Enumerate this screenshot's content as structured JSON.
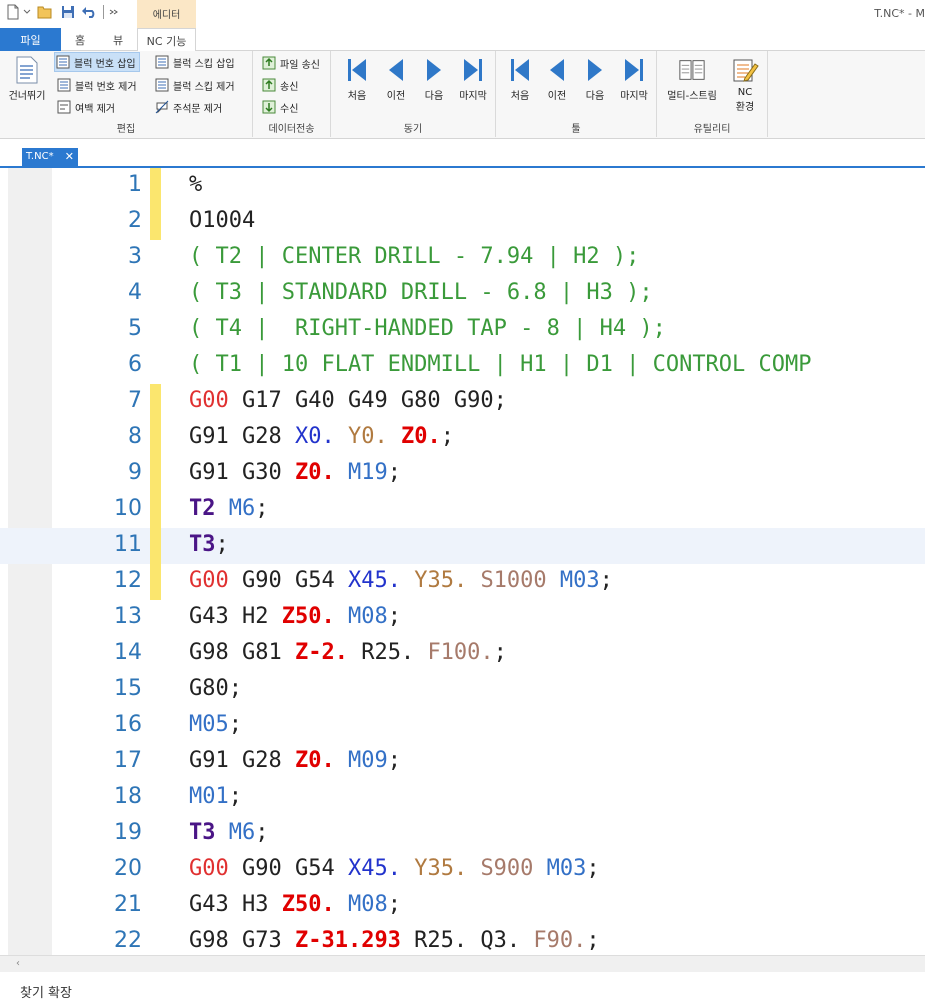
{
  "window": {
    "title": "T.NC* - M"
  },
  "context_tab": {
    "label": "에디터"
  },
  "ribbon_tabs": [
    {
      "label": "파일"
    },
    {
      "label": "홈"
    },
    {
      "label": "뷰"
    },
    {
      "label": "NC 기능"
    }
  ],
  "ribbon": {
    "edit_group": {
      "label": "편집",
      "skip_button": "건너뛰기",
      "items": [
        {
          "label": "블럭 번호 삽입",
          "icon": "block-number-insert-icon"
        },
        {
          "label": "블럭 번호 제거",
          "icon": "block-number-remove-icon"
        },
        {
          "label": "여백 제거",
          "icon": "remove-whitespace-icon"
        },
        {
          "label": "블럭 스킵 삽입",
          "icon": "block-skip-insert-icon"
        },
        {
          "label": "블럭 스킵 제거",
          "icon": "block-skip-remove-icon"
        },
        {
          "label": "주석문 제거",
          "icon": "remove-comment-icon"
        }
      ]
    },
    "transfer_group": {
      "label": "데이터전송",
      "items": [
        {
          "label": "파일 송신",
          "icon": "file-send-icon"
        },
        {
          "label": "송신",
          "icon": "send-icon"
        },
        {
          "label": "수신",
          "icon": "receive-icon"
        }
      ]
    },
    "sync_group": {
      "label": "동기",
      "items": [
        {
          "label": "처음",
          "icon": "first-icon"
        },
        {
          "label": "이전",
          "icon": "previous-icon"
        },
        {
          "label": "다음",
          "icon": "next-icon"
        },
        {
          "label": "마지막",
          "icon": "last-icon"
        }
      ]
    },
    "tool_group": {
      "label": "툴",
      "items": [
        {
          "label": "처음",
          "icon": "first-icon"
        },
        {
          "label": "이전",
          "icon": "previous-icon"
        },
        {
          "label": "다음",
          "icon": "next-icon"
        },
        {
          "label": "마지막",
          "icon": "last-icon"
        }
      ]
    },
    "utility_group": {
      "label": "유틸리티",
      "multi_stream": "멀티-스트림",
      "nc_env_line1": "NC",
      "nc_env_line2": "환경"
    }
  },
  "document_tab": {
    "label": "T.NC*"
  },
  "editor": {
    "lines": [
      {
        "n": "1",
        "mark": true,
        "cur": false,
        "tokens": [
          {
            "t": "%",
            "c": "def"
          }
        ]
      },
      {
        "n": "2",
        "mark": true,
        "cur": false,
        "tokens": [
          {
            "t": "O1004",
            "c": "def"
          }
        ]
      },
      {
        "n": "3",
        "mark": false,
        "cur": false,
        "tokens": [
          {
            "t": "( T2 | CENTER DRILL - 7.94 | H2 );",
            "c": "cmt"
          }
        ]
      },
      {
        "n": "4",
        "mark": false,
        "cur": false,
        "tokens": [
          {
            "t": "( T3 | STANDARD DRILL - 6.8 | H3 );",
            "c": "cmt"
          }
        ]
      },
      {
        "n": "5",
        "mark": false,
        "cur": false,
        "tokens": [
          {
            "t": "( T4 |  RIGHT-HANDED TAP - 8 | H4 );",
            "c": "cmt"
          }
        ]
      },
      {
        "n": "6",
        "mark": false,
        "cur": false,
        "tokens": [
          {
            "t": "( T1 | 10 FLAT ENDMILL | H1 | D1 | CONTROL COMP",
            "c": "cmt"
          }
        ]
      },
      {
        "n": "7",
        "mark": true,
        "cur": false,
        "tokens": [
          {
            "t": "G00",
            "c": "gr"
          },
          {
            "t": " G17 G40 G49 G80 G90;",
            "c": "def"
          }
        ]
      },
      {
        "n": "8",
        "mark": true,
        "cur": false,
        "tokens": [
          {
            "t": "G91 G28 ",
            "c": "def"
          },
          {
            "t": "X0.",
            "c": "x"
          },
          {
            "t": " ",
            "c": "def"
          },
          {
            "t": "Y0.",
            "c": "y"
          },
          {
            "t": " ",
            "c": "def"
          },
          {
            "t": "Z0.",
            "c": "z"
          },
          {
            "t": ";",
            "c": "def"
          }
        ]
      },
      {
        "n": "9",
        "mark": true,
        "cur": false,
        "tokens": [
          {
            "t": "G91 G30 ",
            "c": "def"
          },
          {
            "t": "Z0.",
            "c": "z"
          },
          {
            "t": " ",
            "c": "def"
          },
          {
            "t": "M19",
            "c": "m"
          },
          {
            "t": ";",
            "c": "def"
          }
        ]
      },
      {
        "n": "10",
        "mark": true,
        "cur": false,
        "tokens": [
          {
            "t": "T2",
            "c": "t"
          },
          {
            "t": " ",
            "c": "def"
          },
          {
            "t": "M6",
            "c": "m"
          },
          {
            "t": ";",
            "c": "def"
          }
        ]
      },
      {
        "n": "11",
        "mark": true,
        "cur": true,
        "tokens": [
          {
            "t": "T3",
            "c": "t"
          },
          {
            "t": ";",
            "c": "def"
          }
        ]
      },
      {
        "n": "12",
        "mark": true,
        "cur": false,
        "tokens": [
          {
            "t": "G00",
            "c": "gr"
          },
          {
            "t": " G90 G54 ",
            "c": "def"
          },
          {
            "t": "X45.",
            "c": "x"
          },
          {
            "t": " ",
            "c": "def"
          },
          {
            "t": "Y35.",
            "c": "y"
          },
          {
            "t": " ",
            "c": "def"
          },
          {
            "t": "S1000",
            "c": "s"
          },
          {
            "t": " ",
            "c": "def"
          },
          {
            "t": "M03",
            "c": "m"
          },
          {
            "t": ";",
            "c": "def"
          }
        ]
      },
      {
        "n": "13",
        "mark": false,
        "cur": false,
        "tokens": [
          {
            "t": "G43 H2 ",
            "c": "def"
          },
          {
            "t": "Z50.",
            "c": "z"
          },
          {
            "t": " ",
            "c": "def"
          },
          {
            "t": "M08",
            "c": "m"
          },
          {
            "t": ";",
            "c": "def"
          }
        ]
      },
      {
        "n": "14",
        "mark": false,
        "cur": false,
        "tokens": [
          {
            "t": "G98 G81 ",
            "c": "def"
          },
          {
            "t": "Z-2.",
            "c": "z"
          },
          {
            "t": " R25. ",
            "c": "def"
          },
          {
            "t": "F100.",
            "c": "f"
          },
          {
            "t": ";",
            "c": "def"
          }
        ]
      },
      {
        "n": "15",
        "mark": false,
        "cur": false,
        "tokens": [
          {
            "t": "G80;",
            "c": "def"
          }
        ]
      },
      {
        "n": "16",
        "mark": false,
        "cur": false,
        "tokens": [
          {
            "t": "M05",
            "c": "m"
          },
          {
            "t": ";",
            "c": "def"
          }
        ]
      },
      {
        "n": "17",
        "mark": false,
        "cur": false,
        "tokens": [
          {
            "t": "G91 G28 ",
            "c": "def"
          },
          {
            "t": "Z0.",
            "c": "z"
          },
          {
            "t": " ",
            "c": "def"
          },
          {
            "t": "M09",
            "c": "m"
          },
          {
            "t": ";",
            "c": "def"
          }
        ]
      },
      {
        "n": "18",
        "mark": false,
        "cur": false,
        "tokens": [
          {
            "t": "M01",
            "c": "m"
          },
          {
            "t": ";",
            "c": "def"
          }
        ]
      },
      {
        "n": "19",
        "mark": false,
        "cur": false,
        "tokens": [
          {
            "t": "T3",
            "c": "t"
          },
          {
            "t": " ",
            "c": "def"
          },
          {
            "t": "M6",
            "c": "m"
          },
          {
            "t": ";",
            "c": "def"
          }
        ]
      },
      {
        "n": "20",
        "mark": false,
        "cur": false,
        "tokens": [
          {
            "t": "G00",
            "c": "gr"
          },
          {
            "t": " G90 G54 ",
            "c": "def"
          },
          {
            "t": "X45.",
            "c": "x"
          },
          {
            "t": " ",
            "c": "def"
          },
          {
            "t": "Y35.",
            "c": "y"
          },
          {
            "t": " ",
            "c": "def"
          },
          {
            "t": "S900",
            "c": "s"
          },
          {
            "t": " ",
            "c": "def"
          },
          {
            "t": "M03",
            "c": "m"
          },
          {
            "t": ";",
            "c": "def"
          }
        ]
      },
      {
        "n": "21",
        "mark": false,
        "cur": false,
        "tokens": [
          {
            "t": "G43 H3 ",
            "c": "def"
          },
          {
            "t": "Z50.",
            "c": "z"
          },
          {
            "t": " ",
            "c": "def"
          },
          {
            "t": "M08",
            "c": "m"
          },
          {
            "t": ";",
            "c": "def"
          }
        ]
      },
      {
        "n": "22",
        "mark": false,
        "cur": false,
        "tokens": [
          {
            "t": "G98 G73 ",
            "c": "def"
          },
          {
            "t": "Z-31.293",
            "c": "z"
          },
          {
            "t": " R25. Q3. ",
            "c": "def"
          },
          {
            "t": "F90.",
            "c": "f"
          },
          {
            "t": ";",
            "c": "def"
          }
        ]
      }
    ]
  },
  "find_bar": {
    "label": "찾기 확장"
  },
  "colors": {
    "accent": "#2b79d0",
    "bookmark": "#fbe66e",
    "line_number": "#2e75b6"
  }
}
